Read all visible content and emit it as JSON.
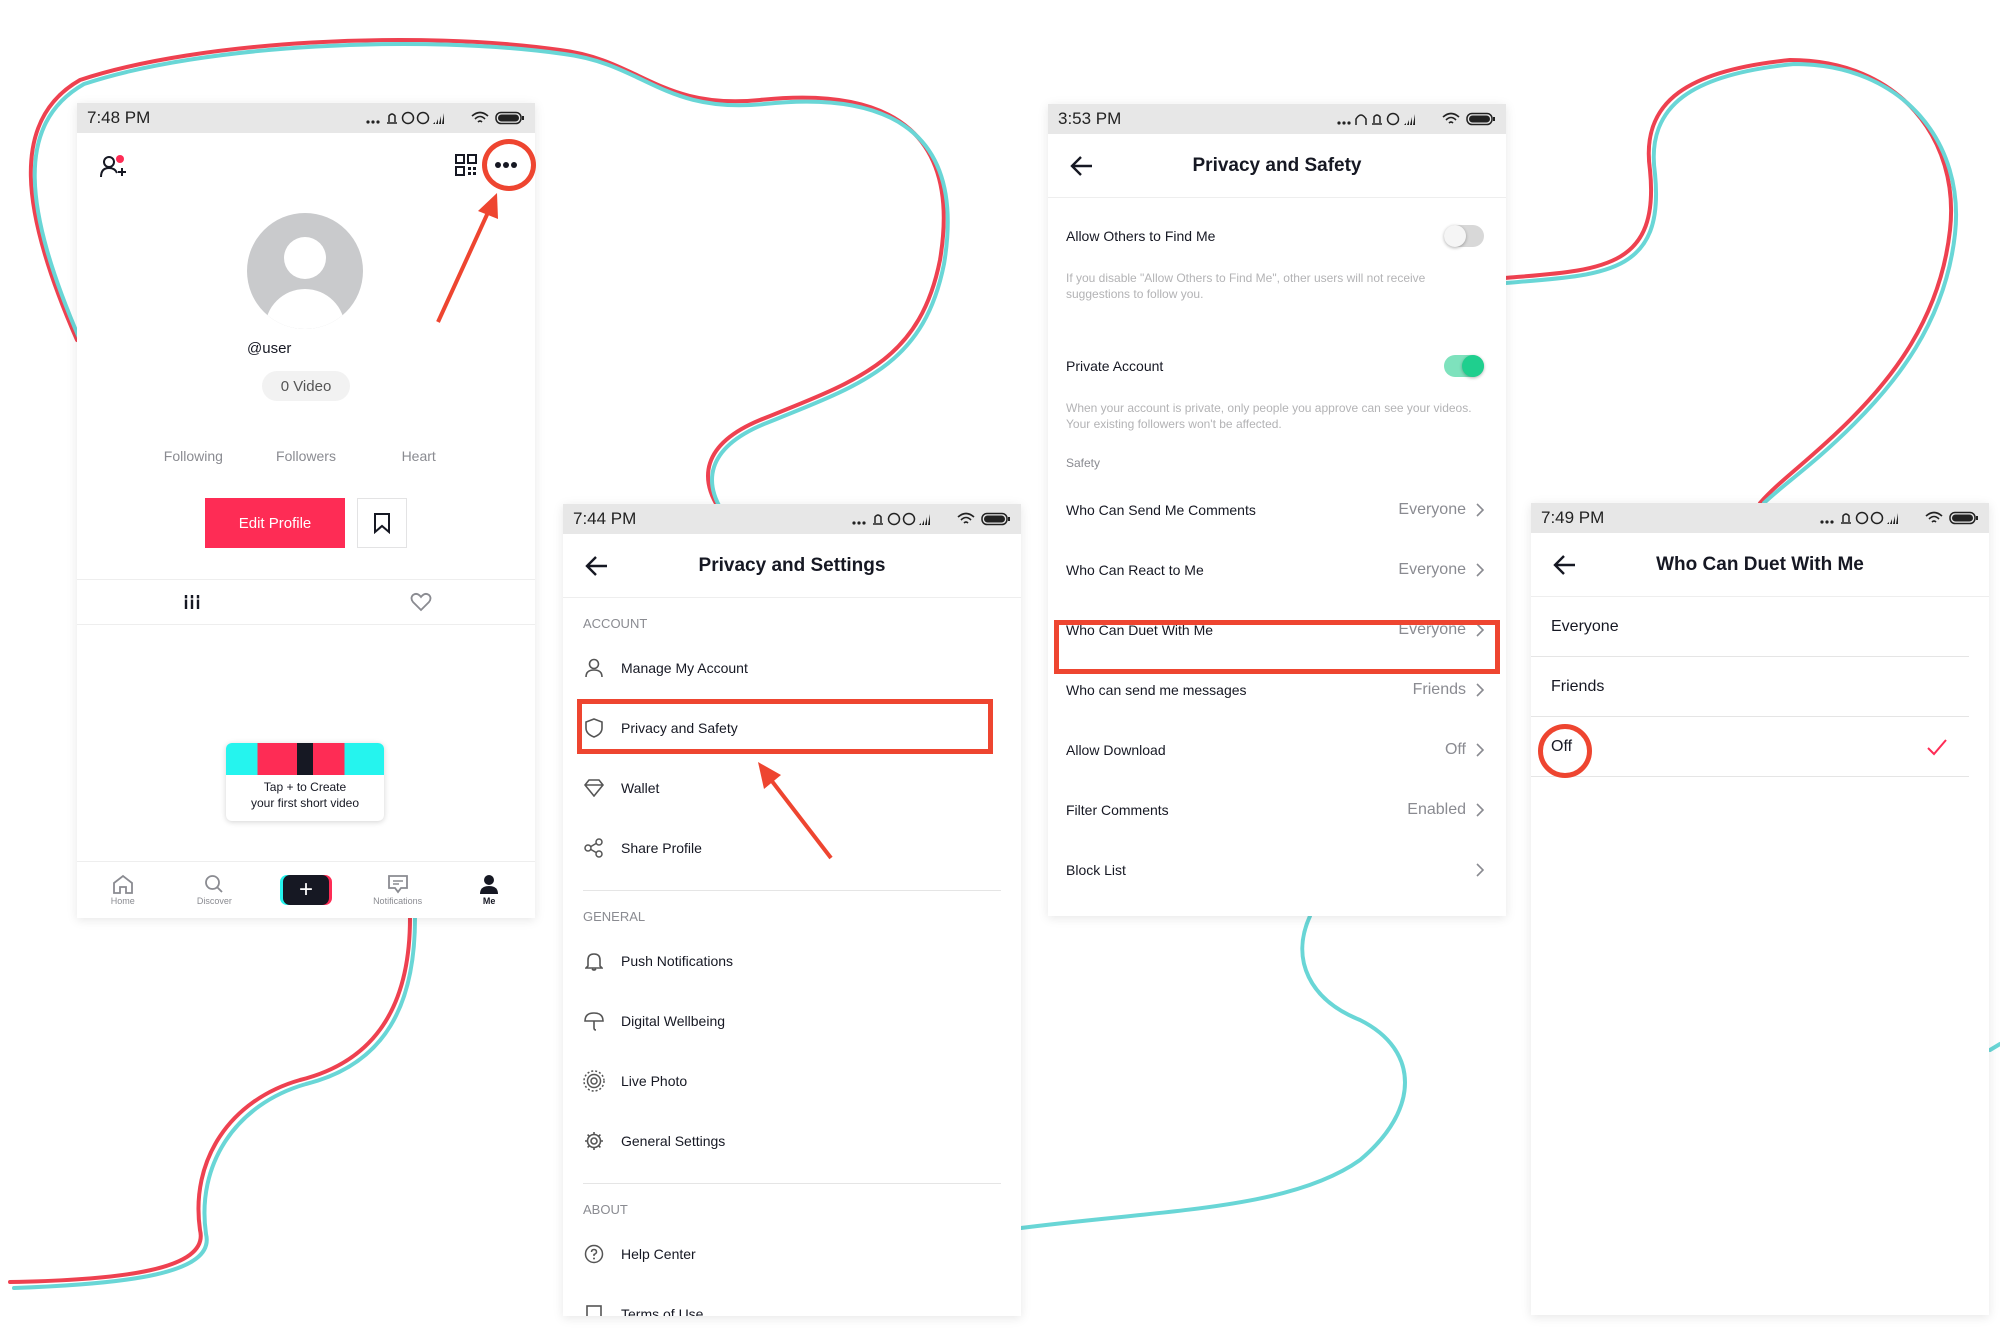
{
  "colors": {
    "accent": "#fe2c55",
    "highlight": "#ee4530",
    "toggle_on": "#1fcf8e",
    "wire_red": "#ee4150",
    "wire_cyan": "#69d6d6"
  },
  "phone1": {
    "time": "7:48 PM",
    "username": "@user",
    "videos": "0 Video",
    "stats": [
      "Following",
      "Followers",
      "Heart"
    ],
    "edit_profile": "Edit Profile",
    "create_tip_line1": "Tap + to Create",
    "create_tip_line2": "your first short video",
    "nav": {
      "home": "Home",
      "discover": "Discover",
      "notifications": "Notifications",
      "me": "Me"
    }
  },
  "phone2": {
    "time": "7:44 PM",
    "title": "Privacy and Settings",
    "section_account": "ACCOUNT",
    "manage_account": "Manage My Account",
    "privacy_safety": "Privacy and Safety",
    "wallet": "Wallet",
    "share_profile": "Share Profile",
    "section_general": "GENERAL",
    "push_notifications": "Push Notifications",
    "digital_wellbeing": "Digital Wellbeing",
    "live_photo": "Live Photo",
    "general_settings": "General Settings",
    "section_about": "ABOUT",
    "help_center": "Help Center",
    "terms_of_use": "Terms of Use"
  },
  "phone3": {
    "time": "3:53 PM",
    "title": "Privacy and Safety",
    "allow_find": "Allow Others to Find Me",
    "allow_find_hint": "If you disable \"Allow Others to Find Me\", other users will not receive suggestions to follow you.",
    "private_account": "Private Account",
    "private_hint": "When your account is private, only people you approve can see your videos. Your existing followers won't be affected.",
    "safety_label": "Safety",
    "rows": [
      {
        "label": "Who Can Send Me Comments",
        "value": "Everyone"
      },
      {
        "label": "Who Can React to Me",
        "value": "Everyone"
      },
      {
        "label": "Who Can Duet With Me",
        "value": "Everyone"
      },
      {
        "label": "Who can send me messages",
        "value": "Friends"
      },
      {
        "label": "Allow Download",
        "value": "Off"
      },
      {
        "label": "Filter Comments",
        "value": "Enabled"
      },
      {
        "label": "Block List",
        "value": ""
      }
    ]
  },
  "phone4": {
    "time": "7:49 PM",
    "title": "Who Can Duet With Me",
    "options": [
      "Everyone",
      "Friends",
      "Off"
    ]
  }
}
